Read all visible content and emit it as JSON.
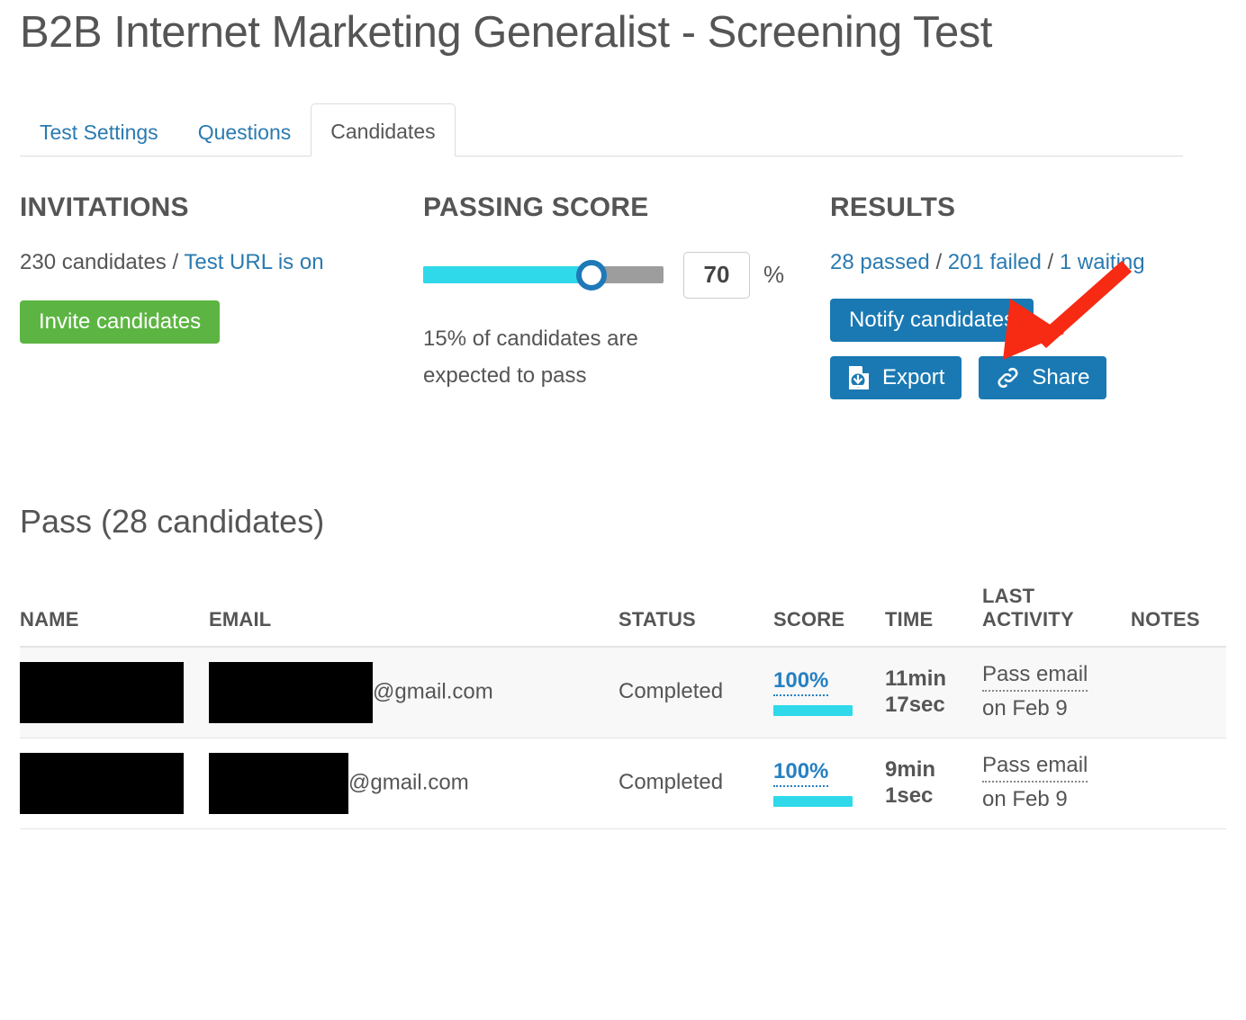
{
  "page": {
    "title": "B2B Internet Marketing Generalist - Screening Test"
  },
  "tabs": [
    {
      "label": "Test Settings",
      "active": false
    },
    {
      "label": "Questions",
      "active": false
    },
    {
      "label": "Candidates",
      "active": true
    }
  ],
  "invitations": {
    "heading": "INVITATIONS",
    "count_text": "230 candidates",
    "separator": "/",
    "url_status_link": "Test URL is on",
    "invite_button": "Invite candidates"
  },
  "passing_score": {
    "heading": "PASSING SCORE",
    "value": "70",
    "percent_sign": "%",
    "slider_percent": 70,
    "note_line1": "15% of candidates are",
    "note_line2": "expected to pass"
  },
  "results": {
    "heading": "RESULTS",
    "passed_link": "28 passed",
    "failed_link": "201 failed",
    "waiting_link": "1 waiting",
    "separator": "/",
    "notify_button": "Notify candidates",
    "export_button": "Export",
    "share_button": "Share"
  },
  "pass_section": {
    "heading": "Pass (28 candidates)",
    "columns": [
      "NAME",
      "EMAIL",
      "STATUS",
      "SCORE",
      "TIME",
      "LAST ACTIVITY",
      "NOTES"
    ],
    "column_last_activity_line1": "LAST",
    "column_last_activity_line2": "ACTIVITY",
    "rows": [
      {
        "name": "",
        "email_domain": "@gmail.com",
        "status": "Completed",
        "score": "100%",
        "score_value": 100,
        "time_line1": "11min",
        "time_line2": "17sec",
        "activity_line1": "Pass email",
        "activity_line2": "on Feb 9",
        "notes": ""
      },
      {
        "name": "",
        "email_domain": "@gmail.com",
        "status": "Completed",
        "score": "100%",
        "score_value": 100,
        "time_line1": "9min",
        "time_line2": "1sec",
        "activity_line1": "Pass email",
        "activity_line2": "on Feb 9",
        "notes": ""
      }
    ]
  },
  "colors": {
    "link_blue": "#2a7ab0",
    "button_blue": "#1a79b3",
    "button_green": "#5cb542",
    "slider_cyan": "#2fd9ea",
    "slider_gray": "#9d9d9d",
    "annotation_red": "#f72a14",
    "text_gray": "#555555"
  },
  "annotation": {
    "arrow_color": "#f72a14",
    "arrow_direction": "down-left",
    "points_at": "28 passed / 201 failed / 1 waiting"
  }
}
